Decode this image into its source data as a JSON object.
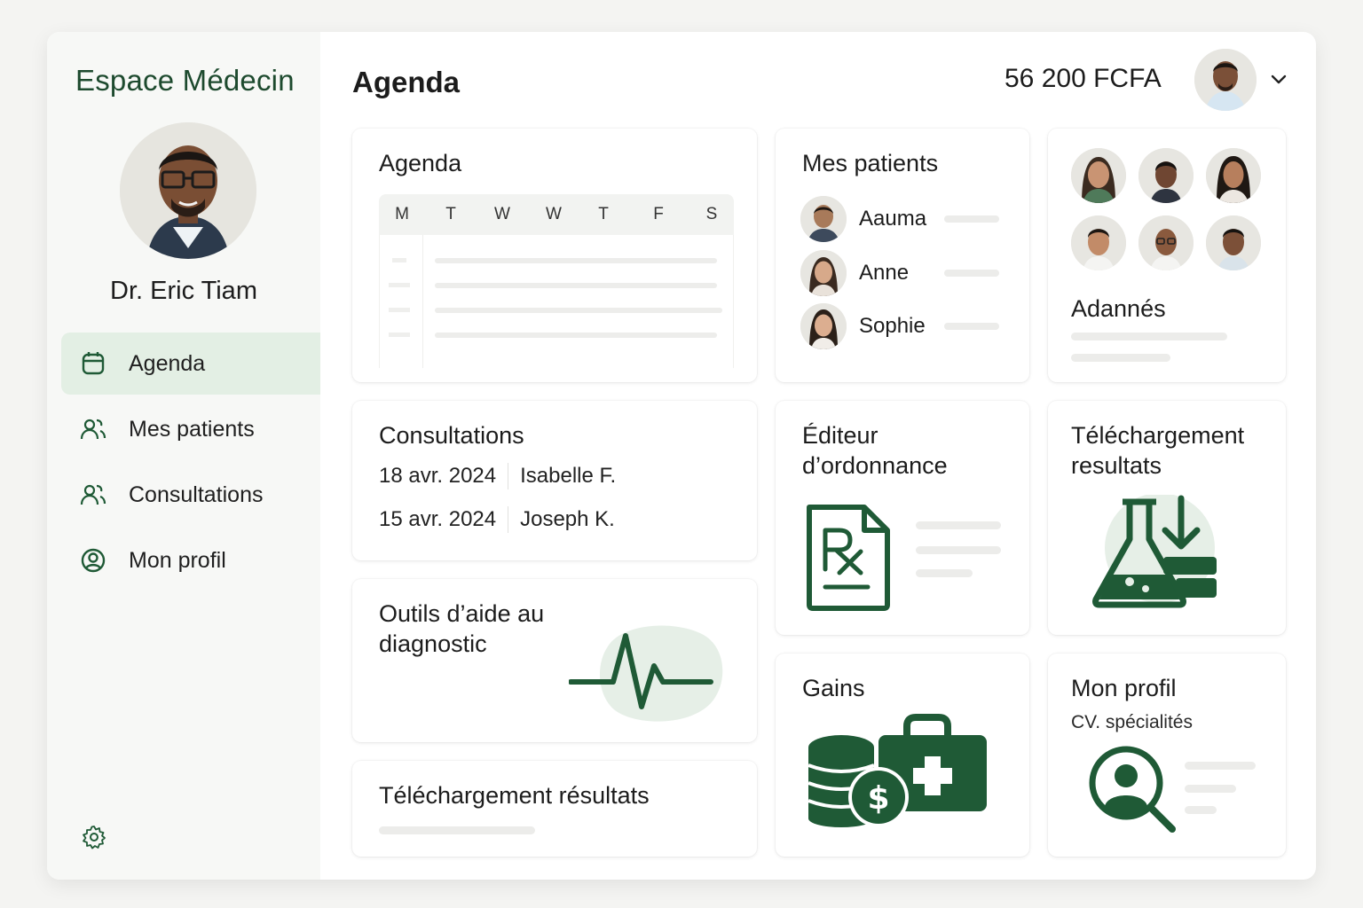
{
  "sidebar": {
    "brand": "Espace Médecin",
    "doctor_name": "Dr. Eric Tiam",
    "items": [
      {
        "label": "Agenda",
        "icon": "calendar-icon",
        "active": true
      },
      {
        "label": "Mes patients",
        "icon": "users-icon",
        "active": false
      },
      {
        "label": "Consultations",
        "icon": "users-icon",
        "active": false
      },
      {
        "label": "Mon profil",
        "icon": "user-circle-icon",
        "active": false
      }
    ],
    "settings_icon": "gear-icon"
  },
  "header": {
    "title": "Agenda",
    "balance": "56 200 FCFA",
    "menu_icon": "chevron-down-icon"
  },
  "cards": {
    "agenda": {
      "title": "Agenda",
      "days": [
        "M",
        "T",
        "W",
        "W",
        "T",
        "F",
        "S"
      ]
    },
    "patients": {
      "title": "Mes patients",
      "list": [
        "Aauma",
        "Anne",
        "Sophie"
      ]
    },
    "followed": {
      "title": "Adannés"
    },
    "consultations": {
      "title": "Consultations",
      "rows": [
        {
          "date": "18 avr. 2024",
          "patient": "Isabelle F."
        },
        {
          "date": "15 avr. 2024",
          "patient": "Joseph K."
        }
      ]
    },
    "prescription": {
      "title": "Éditeur d’ordonnance"
    },
    "lab_results": {
      "title": "Téléchargement resultats"
    },
    "diagnostic": {
      "title": "Outils d’aide au diagnostic"
    },
    "results_upload": {
      "title": "Téléchargement résultats"
    },
    "earnings": {
      "title": "Gains"
    },
    "profile": {
      "title": "Mon profil",
      "subtitle": "CV. spécialités"
    }
  },
  "colors": {
    "accent": "#1f5a36",
    "accent_light": "#e3efe4",
    "brand_text": "#1d4a2e"
  }
}
